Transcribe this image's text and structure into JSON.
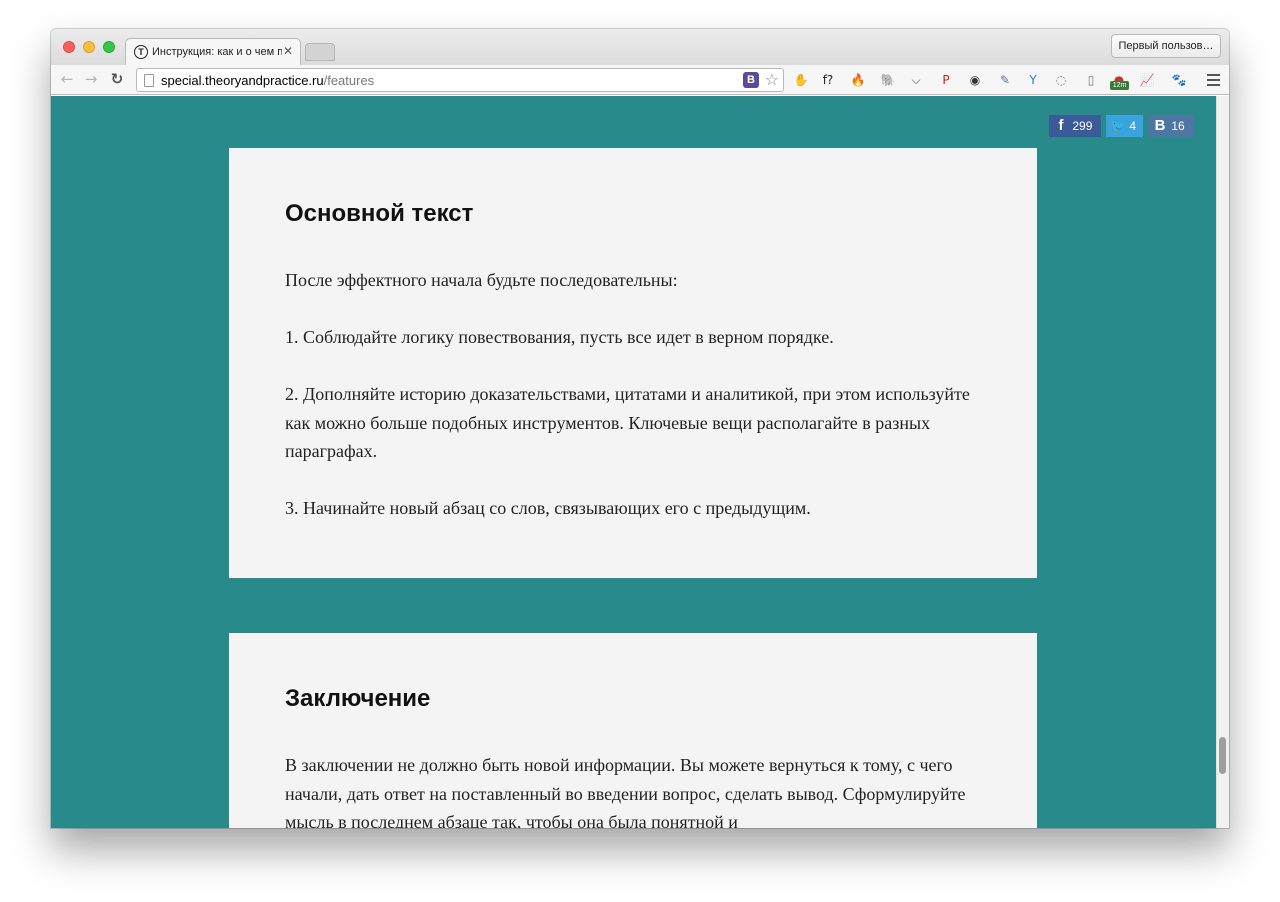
{
  "browser": {
    "tab_title": "Инструкция: как и о чем п",
    "tab_favicon": "Т",
    "tab_close": "✕",
    "profile_button": "Первый пользов…",
    "url_host": "special.theoryandpractice.ru",
    "url_path": "/features",
    "omnibox_ext_label": "B",
    "star_icon": "☆",
    "nav": {
      "back": "←",
      "forward": "→",
      "reload": "↻"
    },
    "extensions": [
      {
        "name": "adblock-icon",
        "glyph": "✋",
        "color": "#d33"
      },
      {
        "name": "font-finder-icon",
        "glyph": "f?",
        "color": "#222"
      },
      {
        "name": "fire-icon",
        "glyph": "🔥",
        "color": "#e8591a"
      },
      {
        "name": "evernote-icon",
        "glyph": "🐘",
        "color": "#555"
      },
      {
        "name": "pocket-icon",
        "glyph": "⌵",
        "color": "#555"
      },
      {
        "name": "pinterest-icon",
        "glyph": "P",
        "color": "#cb2027"
      },
      {
        "name": "camera-icon",
        "glyph": "◉",
        "color": "#333"
      },
      {
        "name": "eyedropper-icon",
        "glyph": "✎",
        "color": "#5a6fa6"
      },
      {
        "name": "vimium-icon",
        "glyph": "Y",
        "color": "#2a7bd5"
      },
      {
        "name": "refresh-ext-icon",
        "glyph": "◌",
        "color": "#777"
      },
      {
        "name": "reader-icon",
        "glyph": "▯",
        "color": "#777"
      },
      {
        "name": "timer-icon",
        "glyph": "●",
        "color": "#c0392b",
        "badge": "12m"
      },
      {
        "name": "analytics-icon",
        "glyph": "📈",
        "color": "#e67e22"
      },
      {
        "name": "paw-icon",
        "glyph": "🐾",
        "color": "#aaa"
      }
    ]
  },
  "share": {
    "facebook_count": "299",
    "twitter_count": "4",
    "vk_count": "16",
    "facebook_icon": "f",
    "twitter_icon": "🐦",
    "vk_icon": "В"
  },
  "sections": [
    {
      "heading": "Основной текст",
      "paragraphs": [
        "После эффектного начала будьте последовательны:",
        "1. Соблюдайте логику повествования, пусть все идет в верном порядке.",
        "2. Дополняйте историю доказательствами, цитатами и аналитикой, при этом используйте как можно больше подобных инструментов. Ключевые вещи располагайте в разных параграфах.",
        "3. Начинайте новый абзац со слов, связывающих его с предыдущим."
      ]
    },
    {
      "heading": "Заключение",
      "paragraphs": [
        "В заключении не должно быть новой информации. Вы можете вернуться к тому, с чего начали, дать ответ на поставленный во введении вопрос, сделать вывод. Сформулируйте мысль в последнем абзаце так, чтобы она была понятной и"
      ]
    }
  ]
}
